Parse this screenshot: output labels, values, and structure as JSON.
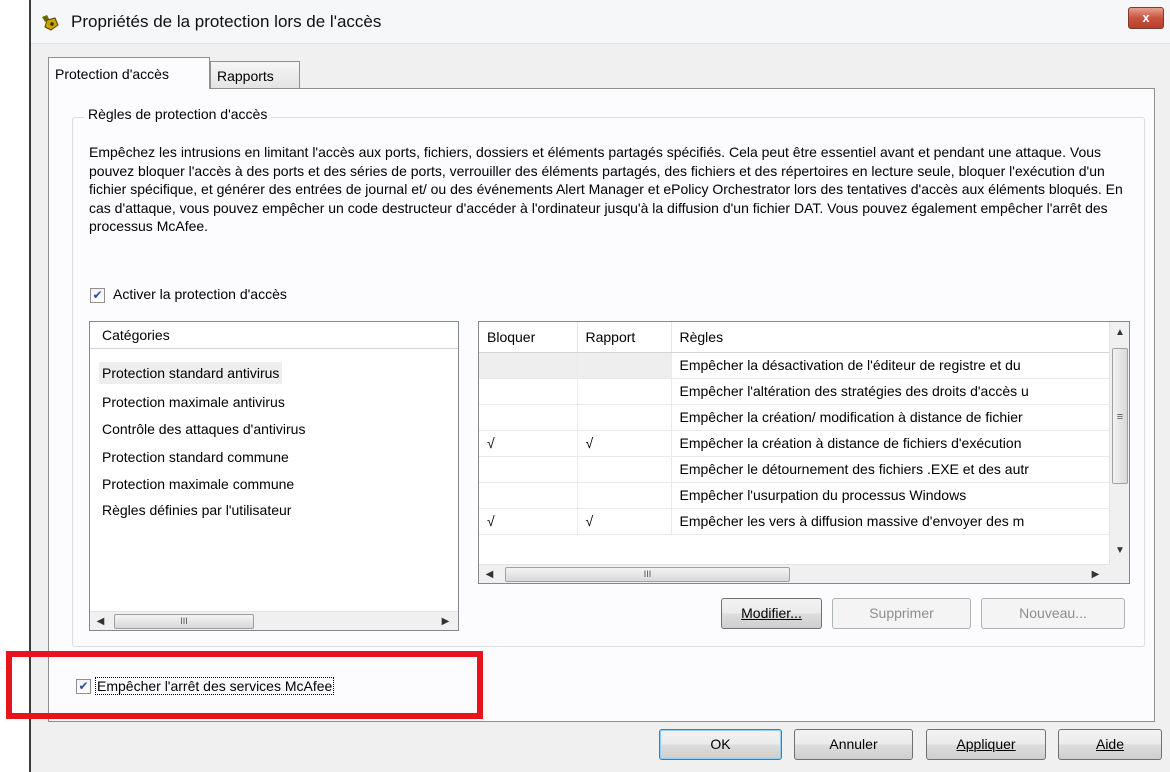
{
  "window": {
    "title": "Propriétés de la protection lors de l'accès",
    "close_label": "x"
  },
  "tabs": [
    {
      "label": "Protection d'accès",
      "active": true
    },
    {
      "label": "Rapports",
      "active": false
    }
  ],
  "group": {
    "label": "Règles de protection d'accès",
    "description": "Empêchez les intrusions en limitant l'accès aux ports, fichiers, dossiers et éléments partagés spécifiés. Cela peut être essentiel avant et pendant une attaque. Vous pouvez bloquer l'accès à des ports et des séries de ports, verrouiller des éléments partagés, des fichiers et des répertoires en lecture seule, bloquer l'exécution d'un fichier spécifique, et générer des entrées de journal et/ ou des événements Alert Manager et ePolicy Orchestrator lors des tentatives d'accès aux éléments bloqués. En cas d'attaque, vous pouvez empêcher un code destructeur d'accéder à l'ordinateur jusqu'à la diffusion d'un fichier DAT. Vous pouvez également empêcher l'arrêt des processus McAfee.",
    "enable_checkbox": {
      "label": "Activer la protection d'accès",
      "checked": true
    }
  },
  "categories": {
    "header": "Catégories",
    "items": [
      "Protection standard antivirus",
      "Protection maximale antivirus",
      "Contrôle des attaques d'antivirus",
      "Protection standard commune",
      "Protection maximale commune",
      "Règles définies par l'utilisateur"
    ],
    "selected_index": 0
  },
  "rules": {
    "columns": [
      "Bloquer",
      "Rapport",
      "Règles"
    ],
    "rows": [
      {
        "block": "",
        "report": "",
        "rule": "Empêcher la désactivation de l'éditeur de registre et du"
      },
      {
        "block": "",
        "report": "",
        "rule": "Empêcher l'altération des stratégies des droits d'accès u"
      },
      {
        "block": "",
        "report": "",
        "rule": "Empêcher la création/ modification à distance de fichier"
      },
      {
        "block": "√",
        "report": "√",
        "rule": "Empêcher la création à distance de fichiers d'exécution"
      },
      {
        "block": "",
        "report": "",
        "rule": "Empêcher le détournement des fichiers .EXE et des autr"
      },
      {
        "block": "",
        "report": "",
        "rule": "Empêcher l'usurpation du processus Windows"
      },
      {
        "block": "√",
        "report": "√",
        "rule": "Empêcher les vers à  diffusion massive d'envoyer des m"
      }
    ]
  },
  "rule_buttons": {
    "edit": "Modifier...",
    "delete": "Supprimer",
    "new": "Nouveau..."
  },
  "services_checkbox": {
    "label": "Empêcher l'arrêt des services McAfee",
    "checked": true
  },
  "footer_buttons": {
    "ok": "OK",
    "cancel": "Annuler",
    "apply": "Appliquer",
    "help": "Aide"
  },
  "colors": {
    "highlight": "#e8141b",
    "check": "#2a4fa8"
  },
  "scroll_glyph": "III"
}
